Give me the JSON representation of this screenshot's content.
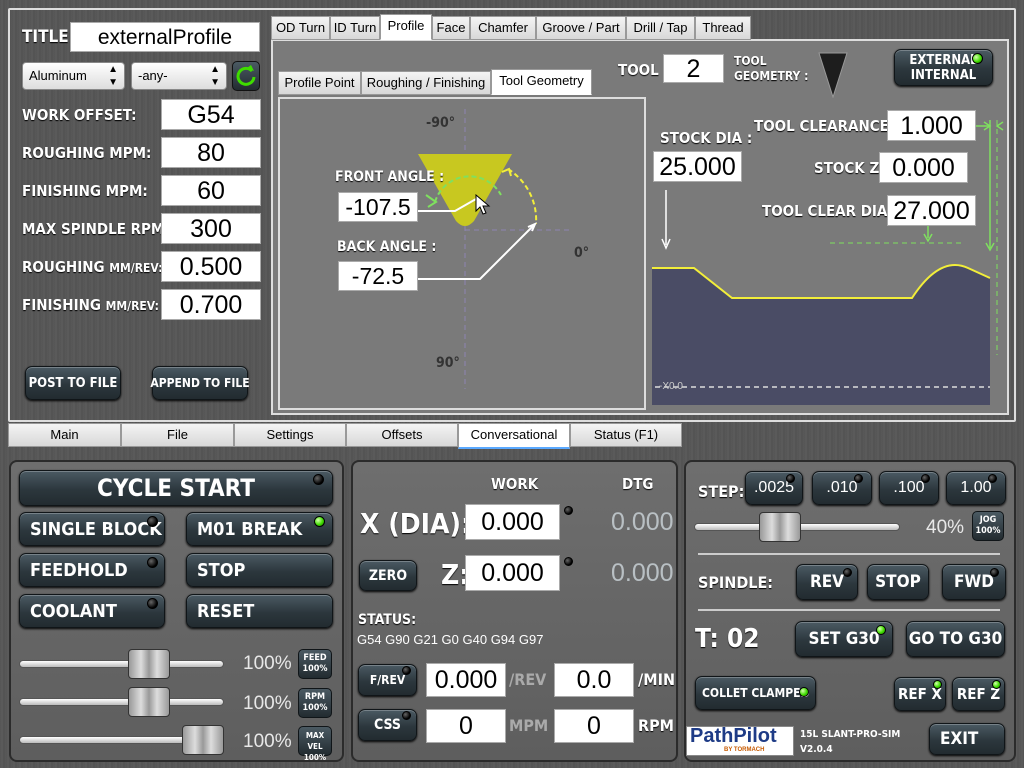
{
  "left_panel": {
    "title_label": "TITLE:",
    "title_value": "externalProfile",
    "material_value": "Aluminum",
    "grade_value": "-any-",
    "work_offset_label": "WORK OFFSET:",
    "work_offset_value": "G54",
    "roughing_mpm_label": "ROUGHING MPM:",
    "roughing_mpm_value": "80",
    "finishing_mpm_label": "FINISHING MPM:",
    "finishing_mpm_value": "60",
    "max_spindle_label": "MAX SPINDLE RPM:",
    "max_spindle_value": "300",
    "roughing_mmrev_label_a": "ROUGHING ",
    "roughing_mmrev_label_b": "MM/REV:",
    "roughing_mmrev_value": "0.500",
    "finishing_mmrev_label_a": "FINISHING ",
    "finishing_mmrev_label_b": "MM/REV:",
    "finishing_mmrev_value": "0.700",
    "post_button": "POST TO FILE",
    "append_button": "APPEND TO FILE"
  },
  "op_tabs": [
    "OD Turn",
    "ID Turn",
    "Profile",
    "Face",
    "Chamfer",
    "Groove / Part",
    "Drill / Tap",
    "Thread"
  ],
  "sub_tabs": [
    "Profile Point",
    "Roughing / Finishing",
    "Tool Geometry"
  ],
  "tool": {
    "tool_label": "TOOL :",
    "tool_value": "2",
    "tool_geometry_label_1": "TOOL",
    "tool_geometry_label_2": "GEOMETRY :",
    "external_label": "EXTERNAL",
    "internal_label": "INTERNAL"
  },
  "geometry": {
    "neg90": "-90°",
    "pos90": "90°",
    "zero": "0°",
    "front_angle_label": "FRONT ANGLE :",
    "front_angle_value": "-107.5",
    "back_angle_label": "BACK ANGLE :",
    "back_angle_value": "-72.5"
  },
  "stock": {
    "stock_dia_label": "STOCK DIA :",
    "stock_dia_value": "25.000",
    "tool_clearance_z_label": "TOOL CLEARANCE Z :",
    "tool_clearance_z_value": "1.000",
    "stock_z_label": "STOCK Z :",
    "stock_z_value": "0.000",
    "tool_clear_dia_x_label": "TOOL CLEAR DIA X :",
    "tool_clear_dia_x_value": "27.000",
    "x0_label": "-X0.0"
  },
  "main_tabs": [
    "Main",
    "File",
    "Settings",
    "Offsets",
    "Conversational",
    "Status (F1)"
  ],
  "cycle": {
    "cycle_start": "CYCLE START",
    "single_block": "SINGLE BLOCK",
    "m01_break": "M01 BREAK",
    "feedhold": "FEEDHOLD",
    "stop": "STOP",
    "coolant": "COOLANT",
    "reset": "RESET",
    "feed_pct": "100%",
    "rpm_pct": "100%",
    "maxvel_pct": "100%",
    "feed_btn_1": "FEED",
    "feed_btn_2": "100%",
    "rpm_btn_1": "RPM",
    "rpm_btn_2": "100%",
    "maxvel_btn_1": "MAX VEL",
    "maxvel_btn_2": "100%"
  },
  "dro": {
    "work_header": "WORK",
    "dtg_header": "DTG",
    "x_label": "X (DIA):",
    "x_work": "0.000",
    "x_dtg": "0.000",
    "z_label": "Z:",
    "z_work": "0.000",
    "z_dtg": "0.000",
    "zero_button": "ZERO",
    "status_label": "STATUS:",
    "status_text": "G54 G90 G21 G0 G40 G94 G97",
    "frev_button": "F/REV",
    "frev_value": "0.000",
    "frev_unit": "/REV",
    "fmin_value": "0.0",
    "fmin_unit": "/MIN",
    "css_button": "CSS",
    "css_value": "0",
    "css_unit": "MPM",
    "rpm_value": "0",
    "rpm_unit": "RPM"
  },
  "jog": {
    "step_label": "STEP:",
    "steps": [
      ".0025",
      ".010",
      ".100",
      "1.00"
    ],
    "jog_pct": "40%",
    "jog_btn_1": "JOG",
    "jog_btn_2": "100%",
    "spindle_label": "SPINDLE:",
    "rev": "REV",
    "stop": "STOP",
    "fwd": "FWD",
    "tool_display": "T: 02",
    "set_g30": "SET G30",
    "go_to_g30": "GO TO G30",
    "collet_clamped": "COLLET CLAMPED",
    "ref_x": "REF X",
    "ref_z": "REF Z",
    "logo_text": "PathPilot",
    "logo_sub": "BY TORMACH",
    "machine_name": "15L SLANT-PRO-SIM",
    "version": "V2.0.4",
    "exit": "EXIT"
  },
  "colors": {
    "tool_yellow": "#c8c820",
    "profile_yellow": "#f2ee3a",
    "arrow_green": "#7fe05f",
    "led_green": "#3fdc00",
    "stock_fill": "#4a4c65"
  }
}
